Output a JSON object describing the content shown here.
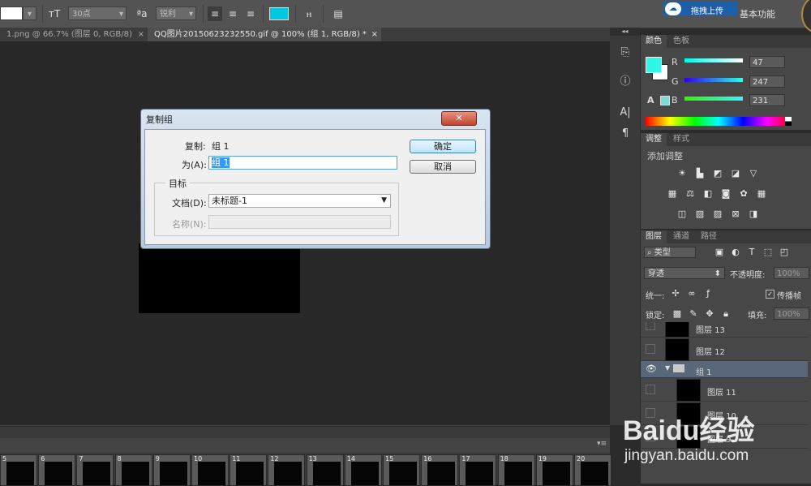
{
  "option_bar": {
    "font_size": "30点",
    "antialias": "锐利",
    "type_icon": "text-orientation-icon",
    "workspace": "基本功能",
    "upload_label": "拖拽上传",
    "color_swatch": "#00c8e0"
  },
  "doc_tabs": [
    {
      "label": "1.png @ 66.7% (图层 0, RGB/8)",
      "close": "×"
    },
    {
      "label": "QQ图片20150623232550.gif @ 100% (组 1, RGB/8) *",
      "close": "×"
    }
  ],
  "dialog": {
    "title": "复制组",
    "close": "✕",
    "copy_label": "复制:",
    "copy_value": "组 1",
    "as_label": "为(A):",
    "as_value": "组 1",
    "target_label": "目标",
    "doc_label": "文档(D):",
    "doc_value": "未标题-1",
    "name_label": "名称(N):",
    "ok_label": "确定",
    "cancel_label": "取消"
  },
  "color_panel": {
    "tabs": [
      "颜色",
      "色板"
    ],
    "r_label": "R",
    "r_value": "47",
    "g_label": "G",
    "g_value": "247",
    "b_label": "B",
    "b_value": "231",
    "fg_color": "#2ff7e7"
  },
  "adjust_panel": {
    "tabs": [
      "调整",
      "样式"
    ],
    "heading": "添加调整"
  },
  "layers_panel": {
    "tabs": [
      "图层",
      "通道",
      "路径"
    ],
    "filter": "类型",
    "blend": "穿透",
    "opacity_label": "不透明度:",
    "opacity_value": "100%",
    "unify_label": "统一:",
    "propagate_label": "传播帧",
    "lock_label": "锁定:",
    "fill_label": "填充:",
    "fill_value": "100%",
    "layers": [
      {
        "name": "图层 13"
      },
      {
        "name": "图层 12"
      },
      {
        "name": "组 1"
      },
      {
        "name": "图层 11"
      },
      {
        "name": "图层 10"
      },
      {
        "name": "图层 9"
      }
    ]
  },
  "timeline": {
    "frames": [
      "5",
      "6",
      "7",
      "8",
      "9",
      "10",
      "11",
      "12",
      "13",
      "14",
      "15",
      "16",
      "17",
      "18",
      "19",
      "20"
    ]
  },
  "watermark": {
    "brand": "Baidu经验",
    "url": "jingyan.baidu.com"
  }
}
